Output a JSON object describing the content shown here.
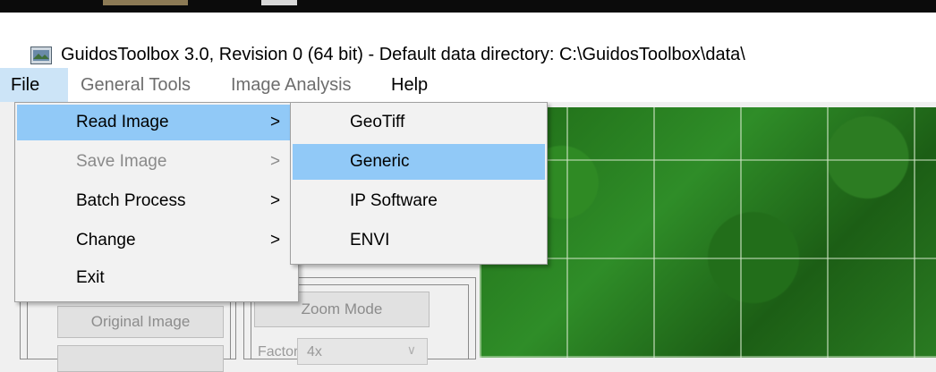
{
  "window": {
    "title": "GuidosToolbox 3.0, Revision 0 (64 bit) - Default data directory: C:\\GuidosToolbox\\data\\"
  },
  "menubar": {
    "items": [
      {
        "label": "File"
      },
      {
        "label": "General Tools"
      },
      {
        "label": "Image Analysis"
      },
      {
        "label": "Help"
      }
    ]
  },
  "file_menu": {
    "items": [
      {
        "label": "Read Image",
        "arrow": ">"
      },
      {
        "label": "Save Image",
        "arrow": ">"
      },
      {
        "label": "Batch Process",
        "arrow": ">"
      },
      {
        "label": "Change",
        "arrow": ">"
      },
      {
        "label": "Exit"
      }
    ]
  },
  "read_image_submenu": {
    "items": [
      {
        "label": "GeoTiff"
      },
      {
        "label": "Generic"
      },
      {
        "label": "IP Software"
      },
      {
        "label": "ENVI"
      }
    ]
  },
  "panel": {
    "original_image_button": "Original Image",
    "zoom_mode_button": "Zoom Mode",
    "factor_label": "Factor:",
    "factor_value": "4x"
  },
  "colors": {
    "highlight": "#91c9f7",
    "menubar_active": "#cce4f7",
    "disabled_text": "#8a8a8a"
  }
}
